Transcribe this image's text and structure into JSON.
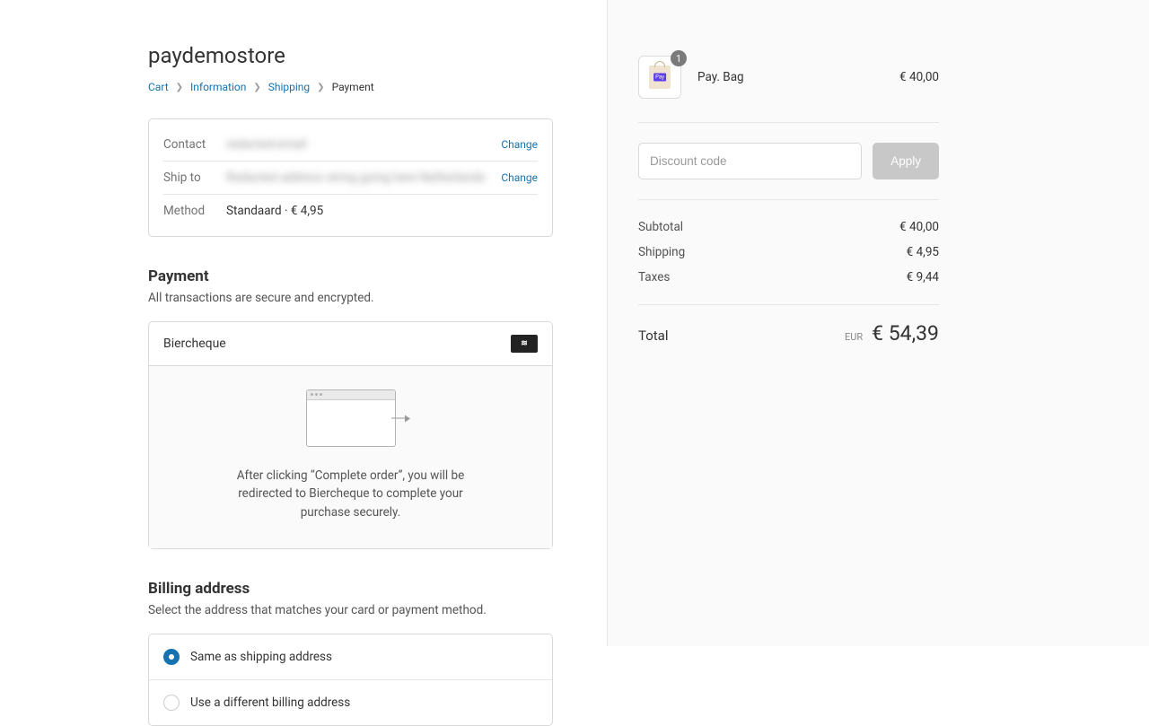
{
  "store_title": "paydemostore",
  "breadcrumb": {
    "cart": "Cart",
    "information": "Information",
    "shipping": "Shipping",
    "payment": "Payment"
  },
  "review": {
    "contact_label": "Contact",
    "contact_value": "redacted-email",
    "shipto_label": "Ship to",
    "shipto_value": "Redacted address string going here Netherlands",
    "method_label": "Method",
    "method_value": "Standaard · € 4,95",
    "change": "Change"
  },
  "payment": {
    "title": "Payment",
    "sub": "All transactions are secure and encrypted.",
    "method_name": "Biercheque",
    "redirect_text": "After clicking “Complete order”, you will be redirected to Biercheque to complete your purchase securely."
  },
  "billing": {
    "title": "Billing address",
    "sub": "Select the address that matches your card or payment method.",
    "same": "Same as shipping address",
    "diff": "Use a different billing address"
  },
  "summary": {
    "product_name": "Pay. Bag",
    "product_price": "€ 40,00",
    "qty": "1",
    "discount_placeholder": "Discount code",
    "apply": "Apply",
    "subtotal_label": "Subtotal",
    "subtotal": "€ 40,00",
    "shipping_label": "Shipping",
    "shipping": "€ 4,95",
    "taxes_label": "Taxes",
    "taxes": "€ 9,44",
    "total_label": "Total",
    "currency": "EUR",
    "total": "€ 54,39"
  }
}
